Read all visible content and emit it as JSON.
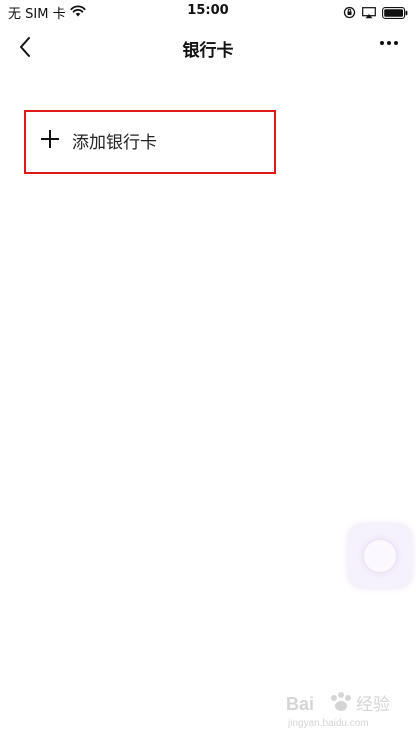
{
  "status_bar": {
    "carrier": "无 SIM 卡",
    "time": "15:00"
  },
  "nav": {
    "title": "银行卡"
  },
  "add_card": {
    "label": "添加银行卡"
  },
  "watermark": {
    "text": "Bai 经验",
    "url": "jingyan.baidu.com"
  },
  "colors": {
    "highlight_border": "#e01818",
    "background": "#ffffff",
    "text": "#111111"
  },
  "icons": {
    "back": "chevron-left-icon",
    "more": "more-dots-icon",
    "add": "plus-icon",
    "wifi": "wifi-icon",
    "rotation_lock": "rotation-lock-icon",
    "airplay": "airplay-icon",
    "battery": "battery-icon"
  }
}
